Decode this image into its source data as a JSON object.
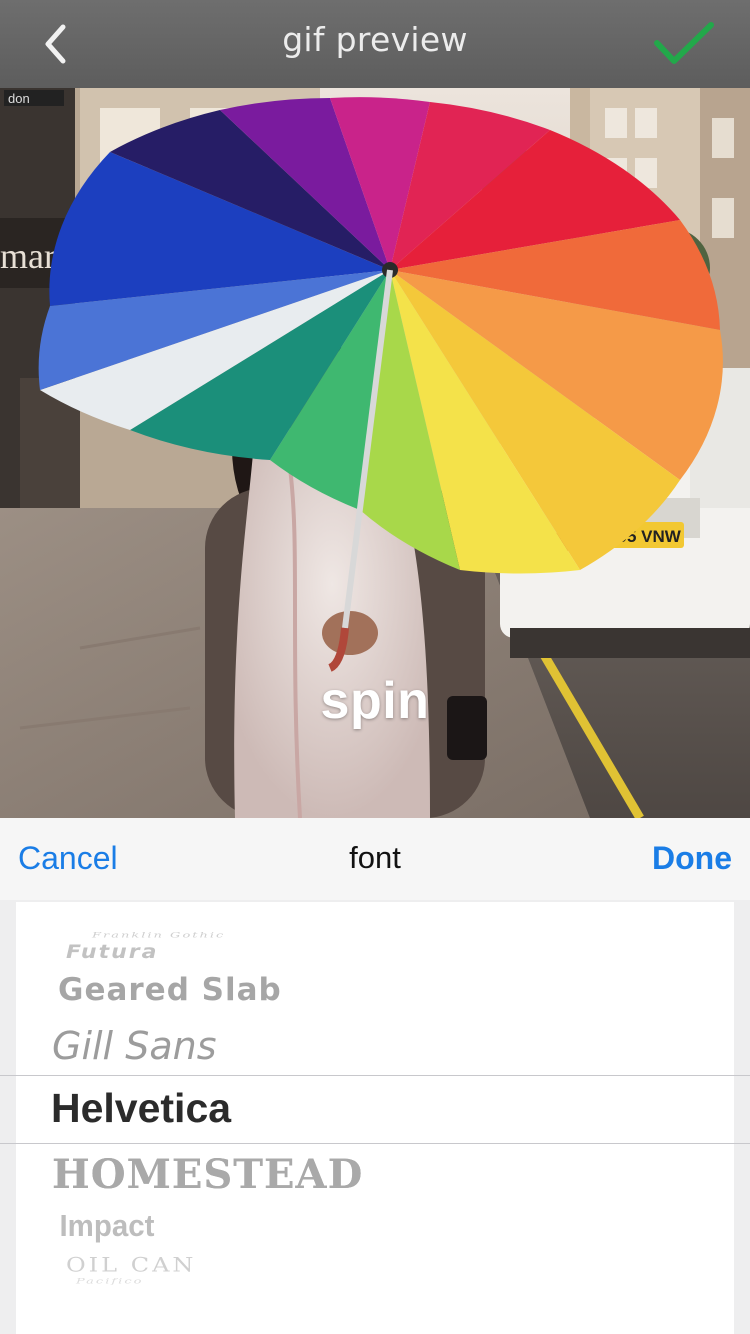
{
  "header": {
    "title": "gif preview",
    "back_icon": "chevron-left-icon",
    "confirm_icon": "checkmark-icon",
    "confirm_color": "#22a84a"
  },
  "preview": {
    "caption": "spin",
    "storefront_sign": "don",
    "storefront_text": "martin",
    "plate_text": "BG05 VNW"
  },
  "picker": {
    "cancel_label": "Cancel",
    "title": "font",
    "done_label": "Done",
    "accent_color": "#1a7de6",
    "fonts": [
      "Franklin Gothic",
      "Futura",
      "Geared Slab",
      "Gill Sans",
      "Helvetica",
      "HOMESTEAD",
      "Impact",
      "OIL CAN",
      "Pacifico"
    ],
    "selected_font": "Helvetica"
  }
}
